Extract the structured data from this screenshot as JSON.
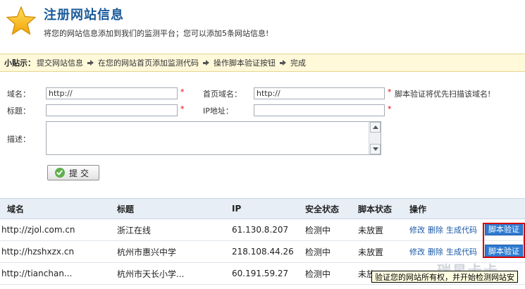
{
  "header": {
    "title": "注册网站信息",
    "subtitle": "将您的网站信息添加到我们的监测平台；您可以添加5条网站信息!"
  },
  "tips": {
    "label": "小贴示：",
    "steps": [
      "提交网站信息",
      "在您的网站首页添加监测代码",
      "操作脚本验证按钮",
      "完成"
    ]
  },
  "form": {
    "domain_label": "域名：",
    "domain_value": "http://",
    "homepage_label": "首页域名：",
    "homepage_value": "http://",
    "required_mark": "*",
    "hint": "脚本验证将优先扫描该域名!",
    "title_label": "标题：",
    "ip_label": "IP地址：",
    "desc_label": "描述：",
    "submit_label": "提交"
  },
  "table": {
    "headers": [
      "域名",
      "标题",
      "IP",
      "安全状态",
      "脚本状态",
      "操作"
    ],
    "rows": [
      {
        "domain": "http://zjol.com.cn",
        "title": "浙江在线",
        "ip": "61.130.8.207",
        "security": "检测中",
        "script": "未放置"
      },
      {
        "domain": "http://hzshxzx.cn",
        "title": "杭州市惠兴中学",
        "ip": "218.108.44.26",
        "security": "检测中",
        "script": "未放置"
      },
      {
        "domain": "http://tianchan...",
        "title": "杭州市天长小学...",
        "ip": "60.191.59.27",
        "security": "检测中",
        "script": "未放"
      }
    ],
    "actions": {
      "edit": "修改",
      "delete": "删除",
      "code": "生成代码",
      "verify": "脚本验证"
    }
  },
  "tooltip": "验证您的网站所有权，并开始检测网站安",
  "watermark": "瑞星卡卡",
  "colors": {
    "title": "#1a5a9a",
    "link": "#1a5aa8",
    "verify_button": "#2f7bd1",
    "highlight": "#d40000",
    "tips_bg": "#fff9da"
  }
}
